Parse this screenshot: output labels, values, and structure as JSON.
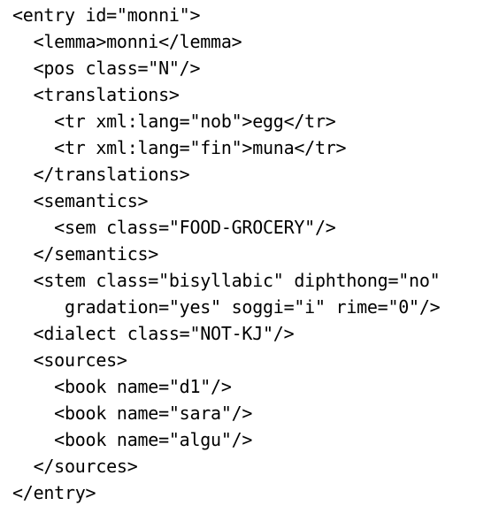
{
  "document": {
    "lines": [
      "<entry id=\"monni\">",
      "  <lemma>monni</lemma>",
      "  <pos class=\"N\"/>",
      "  <translations>",
      "    <tr xml:lang=\"nob\">egg</tr>",
      "    <tr xml:lang=\"fin\">muna</tr>",
      "  </translations>",
      "  <semantics>",
      "    <sem class=\"FOOD-GROCERY\"/>",
      "  </semantics>",
      "  <stem class=\"bisyllabic\" diphthong=\"no\"",
      "     gradation=\"yes\" soggi=\"i\" rime=\"0\"/>",
      "  <dialect class=\"NOT-KJ\"/>",
      "  <sources>",
      "    <book name=\"d1\"/>",
      "    <book name=\"sara\"/>",
      "    <book name=\"algu\"/>",
      "  </sources>",
      "</entry>"
    ]
  }
}
